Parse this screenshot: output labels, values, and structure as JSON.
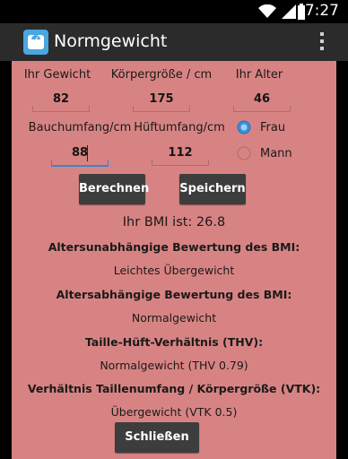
{
  "status_bar": {
    "time": "7:27"
  },
  "app": {
    "title": "Normgewicht"
  },
  "form": {
    "weight": {
      "label": "Ihr Gewicht",
      "value": "82"
    },
    "height": {
      "label": "Körpergröße / cm",
      "value": "175"
    },
    "age": {
      "label": "Ihr Alter",
      "value": "46"
    },
    "waist": {
      "label": "Bauchumfang/cm",
      "value": "88"
    },
    "hip": {
      "label": "Hüftumfang/cm",
      "value": "112"
    },
    "gender": {
      "options": [
        {
          "label": "Frau",
          "selected": true
        },
        {
          "label": "Mann",
          "selected": false
        }
      ]
    }
  },
  "buttons": {
    "calculate": "Berechnen",
    "save": "Speichern",
    "close": "Schließen"
  },
  "results": {
    "bmi": "Ihr BMI ist: 26.8",
    "age_independent_heading": "Altersunabhängige Bewertung des BMI:",
    "age_independent_value": "Leichtes Übergewicht",
    "age_dependent_heading": "Altersabhängige Bewertung des BMI:",
    "age_dependent_value": "Normalgewicht",
    "whr_heading": "Taille-Hüft-Verhältnis (THV):",
    "whr_value": "Normalgewicht (THV 0.79)",
    "whtr_heading": "Verhältnis Taillenumfang / Körpergröße (VTK):",
    "whtr_value": "Übergewicht (VTK 0.5)"
  },
  "colors": {
    "background": "#d88383",
    "action_bar": "#2b2b2b",
    "button": "#3d3d3d",
    "focus_accent": "#3a87c7"
  }
}
